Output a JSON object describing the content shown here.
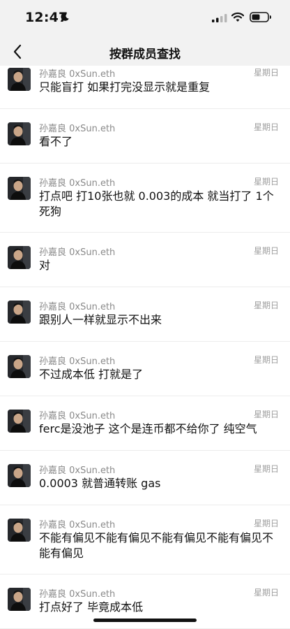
{
  "status_bar": {
    "time": "12:47"
  },
  "header": {
    "title": "按群成员查找"
  },
  "messages": [
    {
      "sender": "孙嘉良 0xSun.eth",
      "date": "星期日",
      "text": "只能盲打 如果打完没显示就是重复"
    },
    {
      "sender": "孙嘉良 0xSun.eth",
      "date": "星期日",
      "text": "看不了"
    },
    {
      "sender": "孙嘉良 0xSun.eth",
      "date": "星期日",
      "text": "打点吧 打10张也就 0.003的成本 就当打了 1个死狗"
    },
    {
      "sender": "孙嘉良 0xSun.eth",
      "date": "星期日",
      "text": "对"
    },
    {
      "sender": "孙嘉良 0xSun.eth",
      "date": "星期日",
      "text": "跟别人一样就显示不出来"
    },
    {
      "sender": "孙嘉良 0xSun.eth",
      "date": "星期日",
      "text": "不过成本低 打就是了"
    },
    {
      "sender": "孙嘉良 0xSun.eth",
      "date": "星期日",
      "text": "ferc是没池子 这个是连币都不给你了 纯空气"
    },
    {
      "sender": "孙嘉良 0xSun.eth",
      "date": "星期日",
      "text": "0.0003 就普通转账 gas"
    },
    {
      "sender": "孙嘉良 0xSun.eth",
      "date": "星期日",
      "text": "不能有偏见不能有偏见不能有偏见不能有偏见不能有偏见"
    },
    {
      "sender": "孙嘉良 0xSun.eth",
      "date": "星期日",
      "text": "打点好了 毕竟成本低"
    }
  ]
}
